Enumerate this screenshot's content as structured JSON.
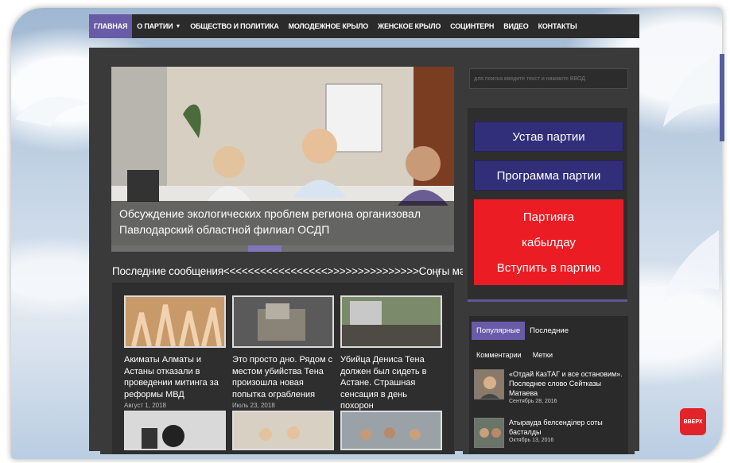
{
  "nav": {
    "items": [
      {
        "label": "ГЛАВНАЯ",
        "active": true
      },
      {
        "label": "О ПАРТИИ",
        "dropdown": true
      },
      {
        "label": "ОБЩЕСТВО И ПОЛИТИКА"
      },
      {
        "label": "МОЛОДЕЖНОЕ КРЫЛО"
      },
      {
        "label": "ЖЕНСКОЕ КРЫЛО"
      },
      {
        "label": "СОЦИНТЕРН"
      },
      {
        "label": "ВИДЕО"
      },
      {
        "label": "КОНТАКТЫ"
      }
    ]
  },
  "slider": {
    "caption": "Обсуждение экологических проблем региона организовал Павлодарский областной филиал ОСДП"
  },
  "latest": {
    "heading": "Последние сообщения<<<<<<<<<<<<<<<<<>>>>>>>>>>>>>>>Соңғы мәлімет",
    "posts": [
      {
        "title": "Акиматы Алматы и Астаны отказали в проведении митинга за реформы МВД",
        "date": "Август 1, 2018"
      },
      {
        "title": "Это просто дно. Рядом с местом убийства Тена произошла новая попытка ограбления",
        "date": "Июль 23, 2018"
      },
      {
        "title": "Убийца Дениса Тена должен был сидеть в Астане. Страшная сенсация в день похорон",
        "date": ""
      }
    ]
  },
  "sidebar": {
    "search_placeholder": "для поиска введите текст и нажмите ВВОД",
    "charter_button": "Устав партии",
    "program_button": "Программа партии",
    "join_kz_line1": "Партияға",
    "join_kz_line2": "кабылдау",
    "join_ru": "Вступить в партию",
    "tabs": [
      "Популярные",
      "Последние"
    ],
    "subtabs": [
      "Комментарии",
      "Метки"
    ],
    "popular": [
      {
        "title": "«Отдай КазТАГ и все остановим». Последнее слово Сейтказы Матаева",
        "date": "Сентябрь 28, 2016"
      },
      {
        "title": "Атырауда белсенділер соты басталды",
        "date": "Октябрь 13, 2016"
      }
    ]
  },
  "back_to_top": "ВВЕРХ",
  "colors": {
    "accent_purple": "#6a5ba8",
    "button_blue": "#312f7a",
    "button_red": "#ec1c24",
    "dark_bg": "#3a3a3a"
  }
}
